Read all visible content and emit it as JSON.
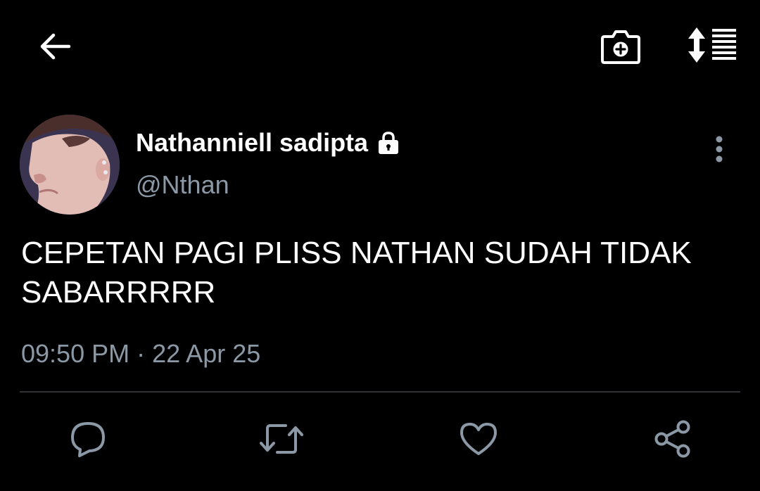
{
  "header": {
    "back_icon": "arrow-left-icon",
    "camera_icon": "camera-add-icon",
    "sort_icon": "sort-list-icon"
  },
  "tweet": {
    "display_name": "Nathanniell sadipta",
    "protected_icon": "lock-icon",
    "handle": "@Nthan",
    "text": "CEPETAN PAGI PLISS NATHAN SUDAH TIDAK\nSABARRRRR",
    "time": "09:50 PM",
    "separator": "·",
    "date": "22 Apr 25"
  },
  "actions": {
    "reply_icon": "reply-icon",
    "retweet_icon": "retweet-icon",
    "like_icon": "heart-icon",
    "share_icon": "share-icon"
  },
  "colors": {
    "background": "#000000",
    "primary_text": "#ffffff",
    "secondary_text": "#8b98a5",
    "icon": "#8b98a5",
    "divider": "#2f3336"
  }
}
